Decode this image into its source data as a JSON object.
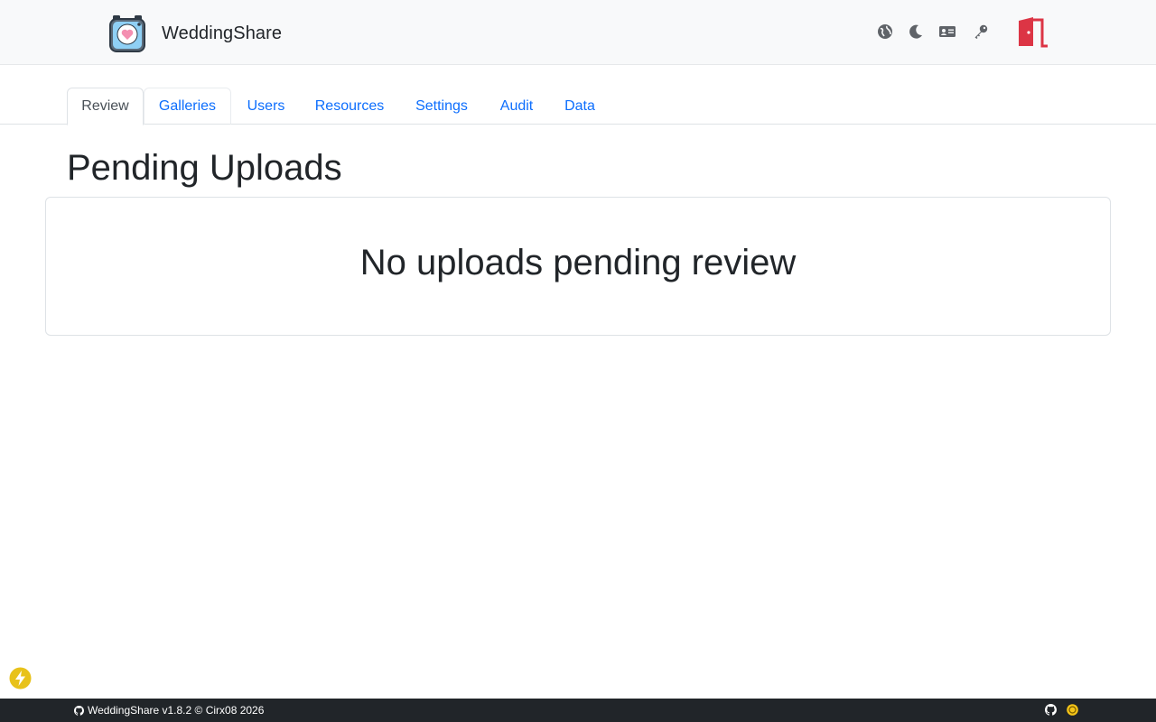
{
  "app": {
    "brand": "WeddingShare"
  },
  "navbar": {
    "icons": [
      "globe-icon",
      "moon-icon",
      "id-card-icon",
      "key-icon",
      "logout-door-icon"
    ]
  },
  "tabs": [
    {
      "label": "Review",
      "active": true
    },
    {
      "label": "Galleries",
      "active": false
    },
    {
      "label": "Users",
      "active": false
    },
    {
      "label": "Resources",
      "active": false
    },
    {
      "label": "Settings",
      "active": false
    },
    {
      "label": "Audit",
      "active": false
    },
    {
      "label": "Data",
      "active": false
    }
  ],
  "main": {
    "title": "Pending Uploads",
    "empty_message": "No uploads pending review"
  },
  "footer": {
    "text": "WeddingShare v1.8.2 © Cirx08 2026"
  },
  "colors": {
    "link": "#0d6efd",
    "logout": "#dc3545",
    "footer_bg": "#212529",
    "accent_yellow": "#f5c518"
  }
}
